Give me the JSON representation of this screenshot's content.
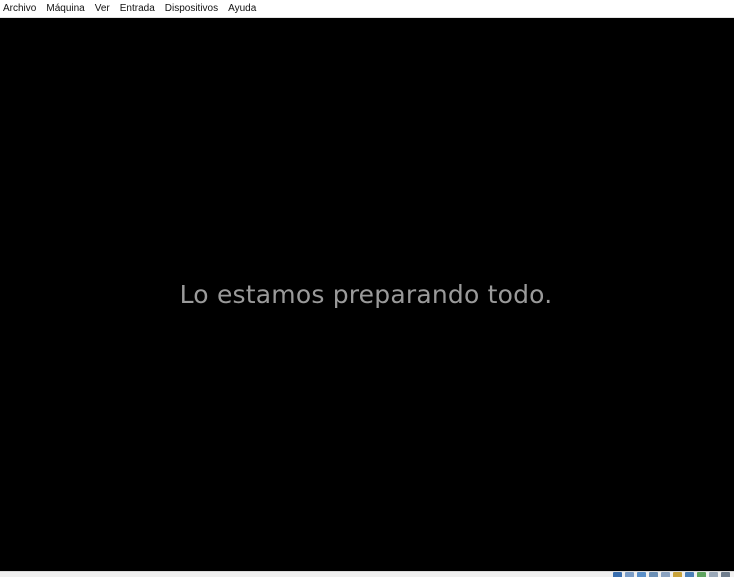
{
  "menubar": {
    "items": [
      "Archivo",
      "Máquina",
      "Ver",
      "Entrada",
      "Dispositivos",
      "Ayuda"
    ]
  },
  "screen": {
    "message": "Lo estamos preparando todo."
  },
  "statusbar": {
    "icons": [
      {
        "name": "hard-disk-icon",
        "color": "#3a6fb0"
      },
      {
        "name": "optical-drive-icon",
        "color": "#7a9cc6"
      },
      {
        "name": "audio-icon",
        "color": "#5a8fc8"
      },
      {
        "name": "network-icon",
        "color": "#6b8fb5"
      },
      {
        "name": "usb-icon",
        "color": "#8aa2c0"
      },
      {
        "name": "shared-folder-icon",
        "color": "#c9a33a"
      },
      {
        "name": "display-icon",
        "color": "#4a7fb8"
      },
      {
        "name": "video-capture-icon",
        "color": "#5ea35e"
      },
      {
        "name": "mouse-integration-icon",
        "color": "#9aa8b8"
      },
      {
        "name": "host-key-icon",
        "color": "#707d8d"
      }
    ]
  }
}
